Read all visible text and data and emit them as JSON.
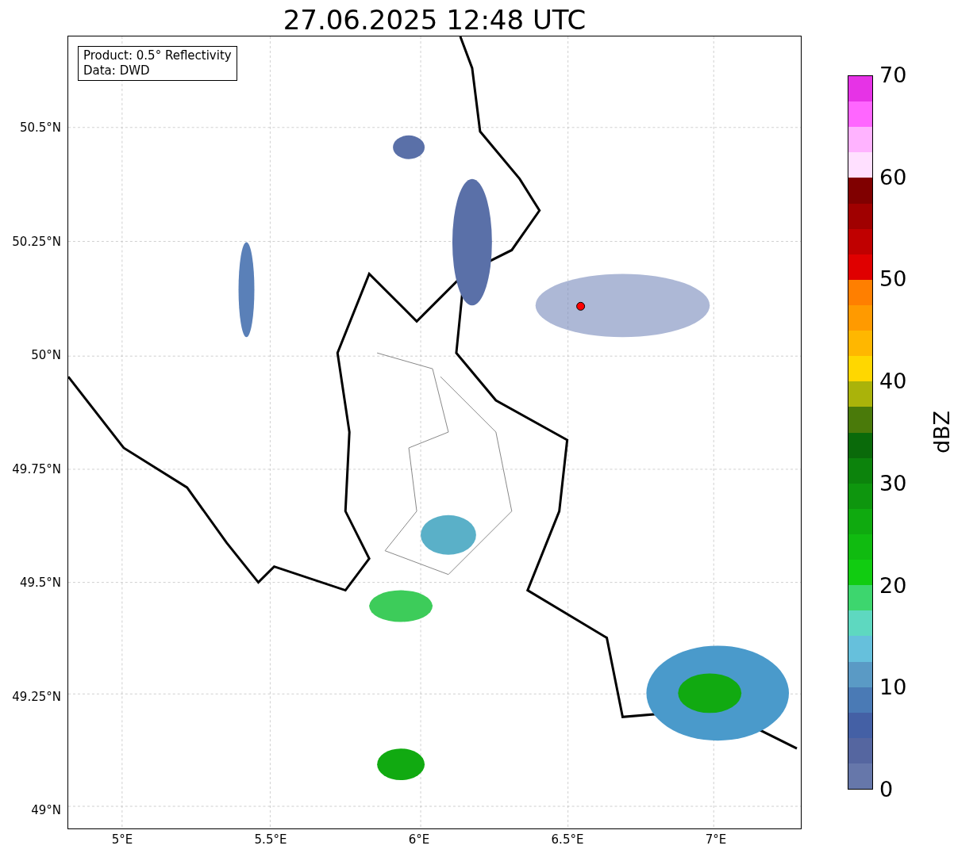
{
  "title": "27.06.2025 12:48 UTC",
  "map": {
    "info_lines": [
      "Product: 0.5° Reflectivity",
      "Data: DWD"
    ],
    "lat_ticks": [
      "50.5°N",
      "50.25°N",
      "50°N",
      "49.75°N",
      "49.5°N",
      "49.25°N",
      "49°N"
    ],
    "lon_ticks": [
      "5°E",
      "5.5°E",
      "6°E",
      "6.5°E",
      "7°E"
    ]
  },
  "colorbar": {
    "label": "dBZ",
    "ticks": [
      "70",
      "60",
      "50",
      "40",
      "30",
      "20",
      "10",
      "0"
    ],
    "bands": [
      {
        "color": "#e633e6"
      },
      {
        "color": "#ff66ff"
      },
      {
        "color": "#ffb3ff"
      },
      {
        "color": "#ffe0ff"
      },
      {
        "color": "#800000"
      },
      {
        "color": "#a00000"
      },
      {
        "color": "#c00000"
      },
      {
        "color": "#e00000"
      },
      {
        "color": "#ff7f00"
      },
      {
        "color": "#ff9a00"
      },
      {
        "color": "#ffb700"
      },
      {
        "color": "#ffd700"
      },
      {
        "color": "#aab30a"
      },
      {
        "color": "#4a7a0a"
      },
      {
        "color": "#0a6a0a"
      },
      {
        "color": "#0c830c"
      },
      {
        "color": "#0e960e"
      },
      {
        "color": "#0faa0f"
      },
      {
        "color": "#10bb10"
      },
      {
        "color": "#11cc11"
      },
      {
        "color": "#3dd66e"
      },
      {
        "color": "#5ed8c0"
      },
      {
        "color": "#66c0dc"
      },
      {
        "color": "#5a9ac5"
      },
      {
        "color": "#4a7ab5"
      },
      {
        "color": "#4460a5"
      },
      {
        "color": "#5566a0"
      },
      {
        "color": "#6677aa"
      }
    ]
  }
}
